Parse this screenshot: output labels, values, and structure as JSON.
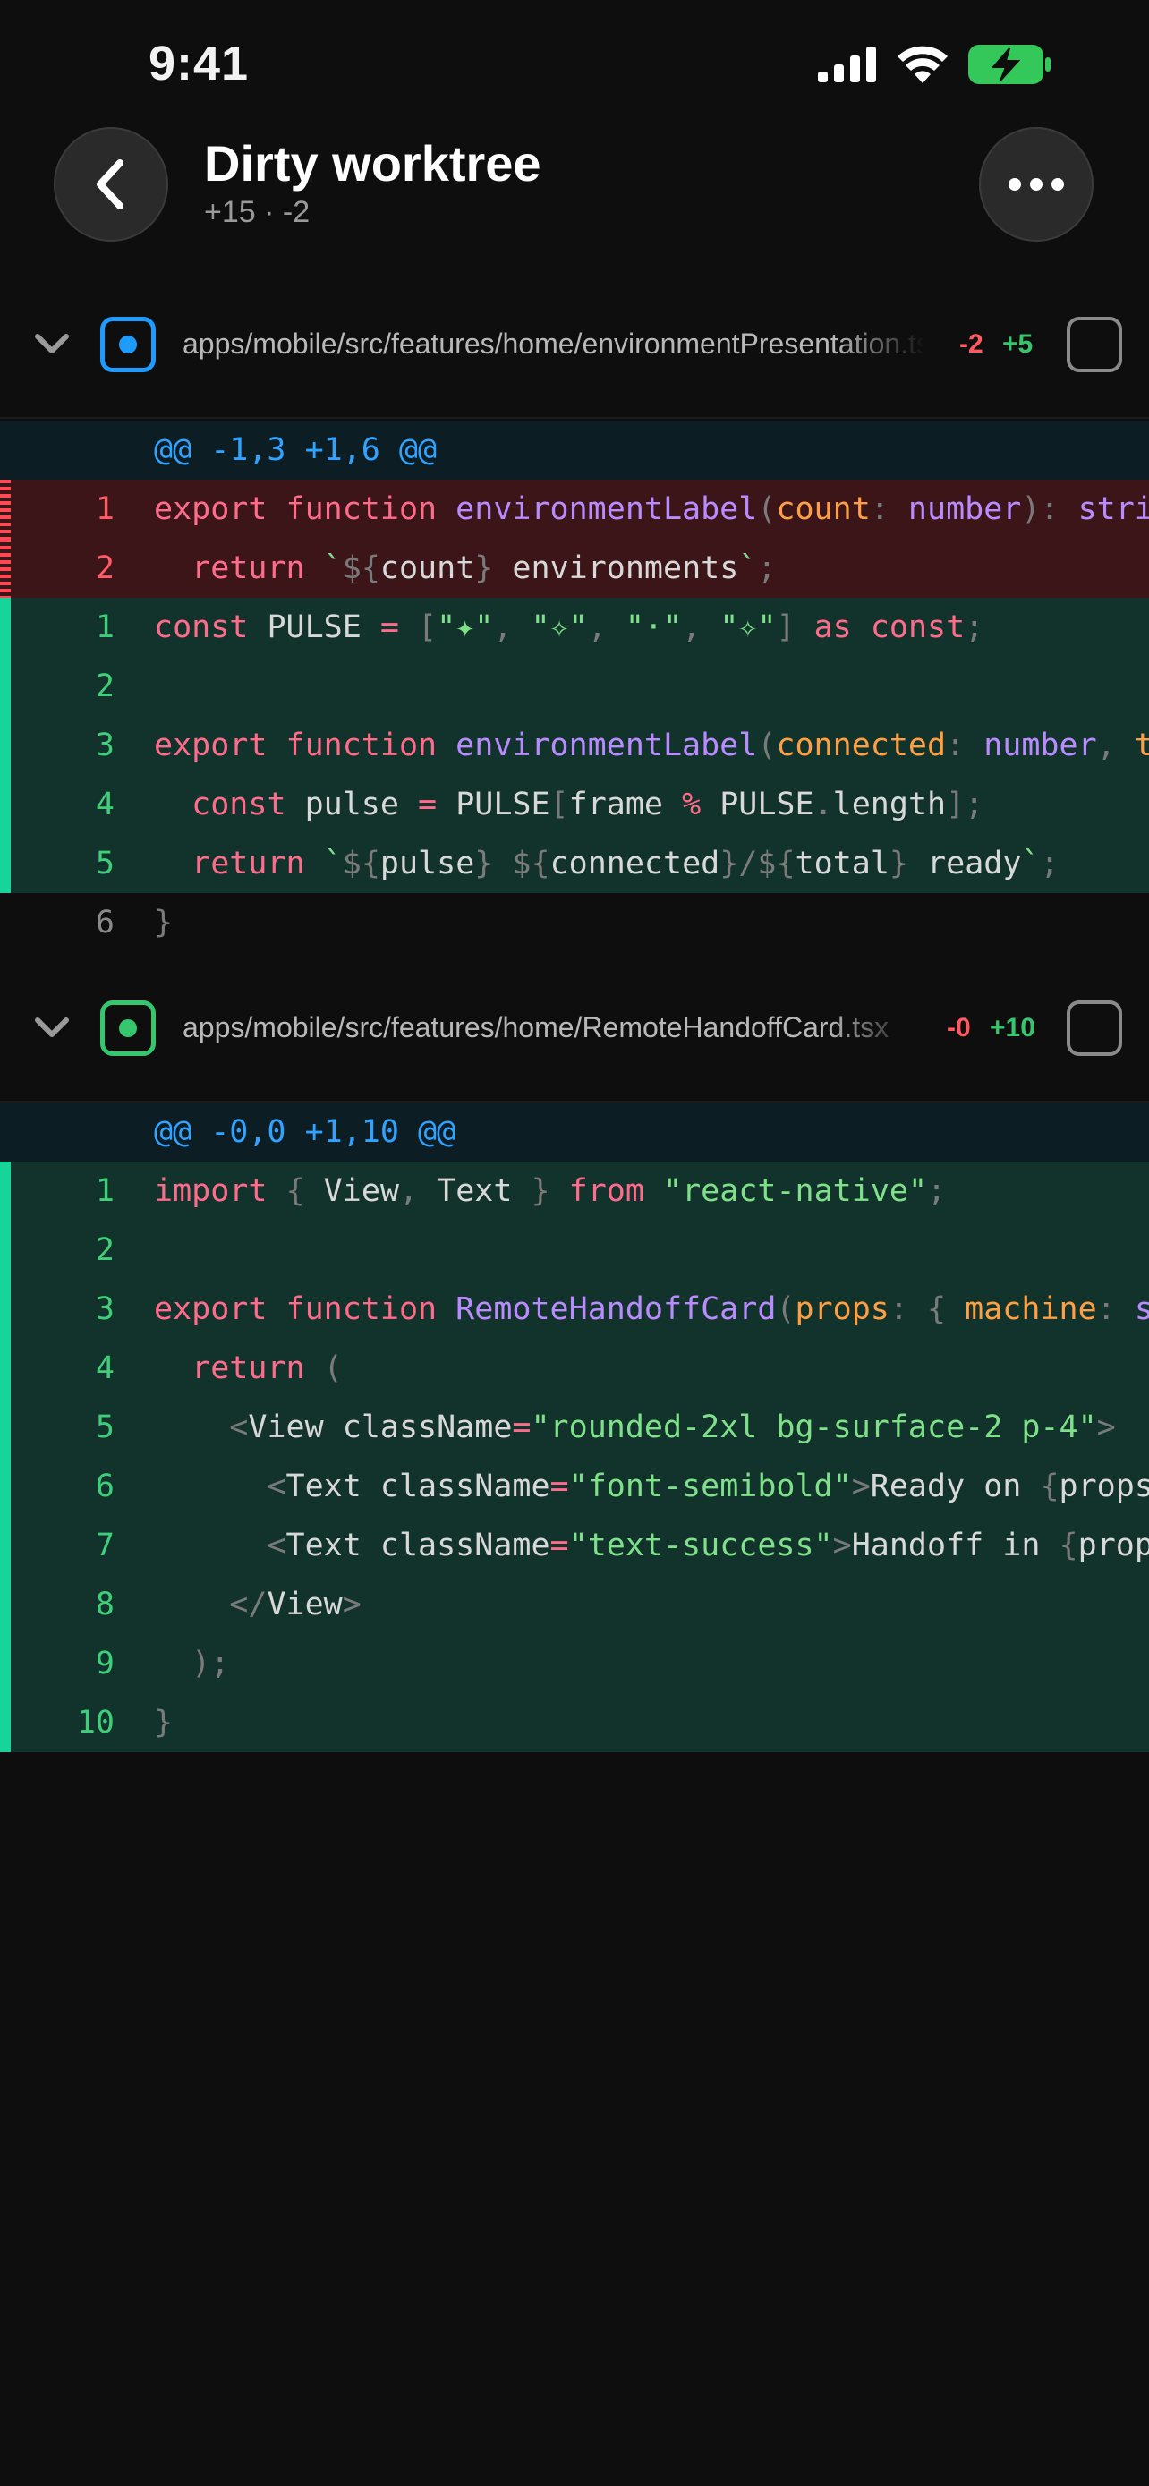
{
  "status_bar": {
    "time": "9:41"
  },
  "header": {
    "title": "Dirty worktree",
    "subtitle": "+15 · -2"
  },
  "files": [
    {
      "path": "apps/mobile/src/features/home/environmentPresentation.ts",
      "deletions": "-2",
      "additions": "+5",
      "hunk": "@@ -1,3 +1,6 @@",
      "accent": "#1e9bff"
    },
    {
      "path": "apps/mobile/src/features/home/RemoteHandoffCard.tsx",
      "deletions": "-0",
      "additions": "+10",
      "hunk": "@@ -0,0 +1,10 @@",
      "accent": "#34c76d"
    }
  ],
  "diff1": [
    {
      "type": "del",
      "ln": "1",
      "code": "export function environmentLabel(count: number): string {"
    },
    {
      "type": "del",
      "ln": "2",
      "code": "  return `${count} environments`;"
    },
    {
      "type": "add",
      "ln": "1",
      "code": "const PULSE = [\"✦\", \"✧\", \"·\", \"✧\"] as const;"
    },
    {
      "type": "add",
      "ln": "2",
      "code": ""
    },
    {
      "type": "add",
      "ln": "3",
      "code": "export function environmentLabel(connected: number, total: number, frame: number) {"
    },
    {
      "type": "add",
      "ln": "4",
      "code": "  const pulse = PULSE[frame % PULSE.length];"
    },
    {
      "type": "add",
      "ln": "5",
      "code": "  return `${pulse} ${connected}/${total} ready`;"
    },
    {
      "type": "ctx",
      "ln": "6",
      "code": "}"
    }
  ],
  "diff2": [
    {
      "type": "add",
      "ln": "1",
      "code": "import { View, Text } from \"react-native\";"
    },
    {
      "type": "add",
      "ln": "2",
      "code": ""
    },
    {
      "type": "add",
      "ln": "3",
      "code": "export function RemoteHandoffCard(props: { machine: string; eta: string }) {"
    },
    {
      "type": "add",
      "ln": "4",
      "code": "  return ("
    },
    {
      "type": "add",
      "ln": "5",
      "code": "    <View className=\"rounded-2xl bg-surface-2 p-4\">"
    },
    {
      "type": "add",
      "ln": "6",
      "code": "      <Text className=\"font-semibold\">Ready on {props.machine}</Text>"
    },
    {
      "type": "add",
      "ln": "7",
      "code": "      <Text className=\"text-success\">Handoff in {props.eta}</Text>"
    },
    {
      "type": "add",
      "ln": "8",
      "code": "    </View>"
    },
    {
      "type": "add",
      "ln": "9",
      "code": "  );"
    },
    {
      "type": "add",
      "ln": "10",
      "code": "}"
    }
  ]
}
